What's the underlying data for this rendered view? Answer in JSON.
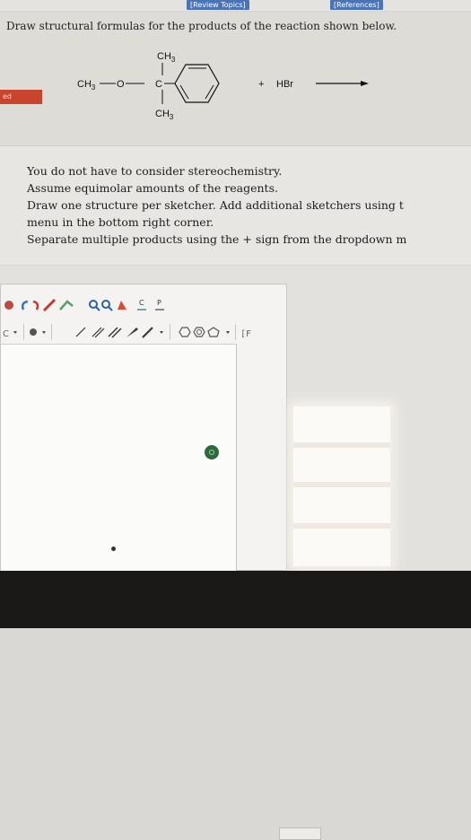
{
  "nav": {
    "review_topics": "[Review Topics]",
    "references": "[References]"
  },
  "question": {
    "prompt": "Draw structural formulas for the products of the reaction shown below.",
    "tab_label": "ed",
    "reaction": {
      "ch3_top": "CH3",
      "ch3_left": "CH3",
      "o_label": "O",
      "c_label": "C",
      "ch3_bottom": "CH3",
      "plus": "+",
      "reagent": "HBr"
    }
  },
  "instructions": [
    {
      "text": "You do not have to consider stereochemistry.",
      "cont": ""
    },
    {
      "text": "Assume equimolar amounts of the reagents.",
      "cont": ""
    },
    {
      "text": "Draw one structure per sketcher. Add additional sketchers using t",
      "cont": "menu in the bottom right corner."
    },
    {
      "text": "Separate multiple products using the + sign from the dropdown m",
      "cont": ""
    }
  ],
  "toolbar": {
    "chain_label": "C",
    "periodic_label": "P"
  }
}
